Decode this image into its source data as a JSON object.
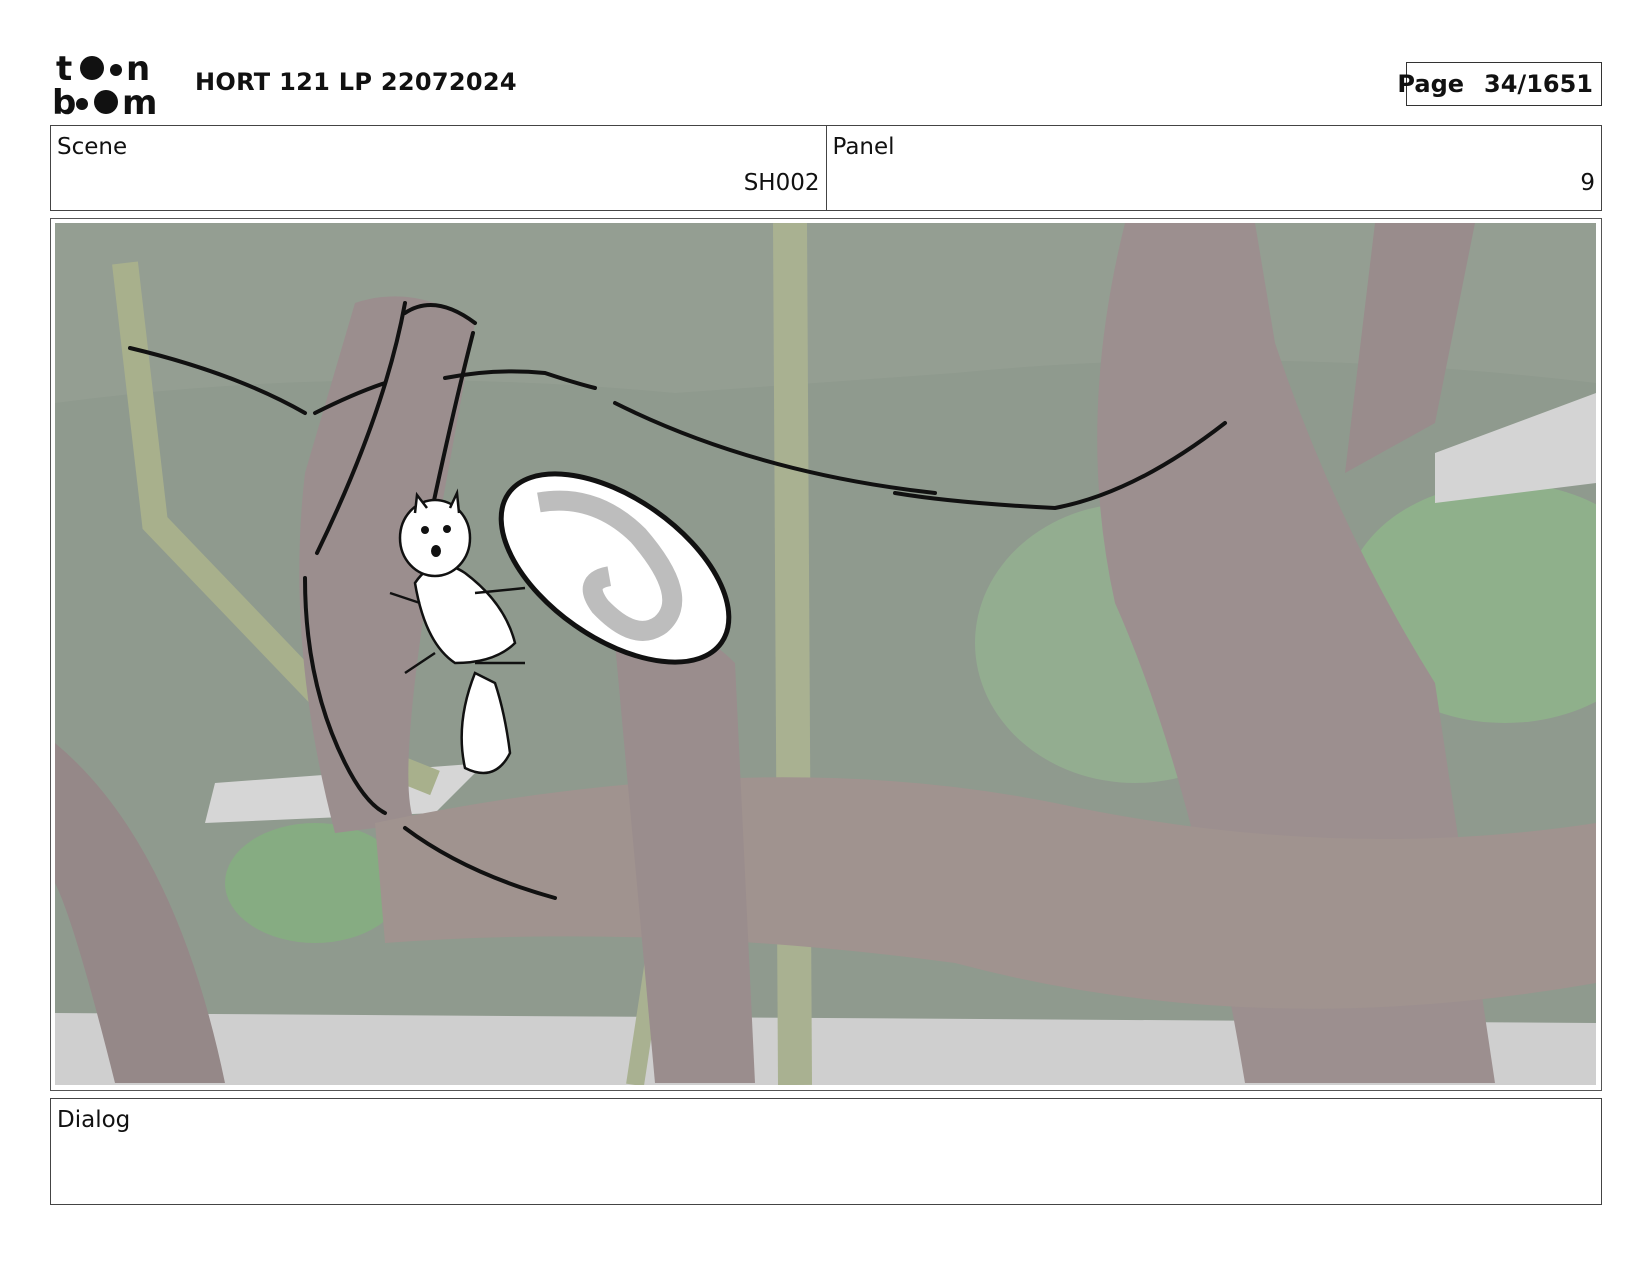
{
  "header": {
    "logo_text": "toon boom",
    "title": "HORT 121 LP 22072024",
    "page_label": "Page",
    "page_value": "34/1651"
  },
  "scene": {
    "label": "Scene",
    "value": "SH002"
  },
  "panel": {
    "label": "Panel",
    "value": "9"
  },
  "artwork": {
    "description_icon": "storyboard-panel-drawing",
    "colors": {
      "background": "#8f9a8e",
      "trunk": "#9c8f8f",
      "foliage": "#8fa88c",
      "ink": "#111111"
    }
  },
  "dialog": {
    "label": "Dialog",
    "text": ""
  }
}
